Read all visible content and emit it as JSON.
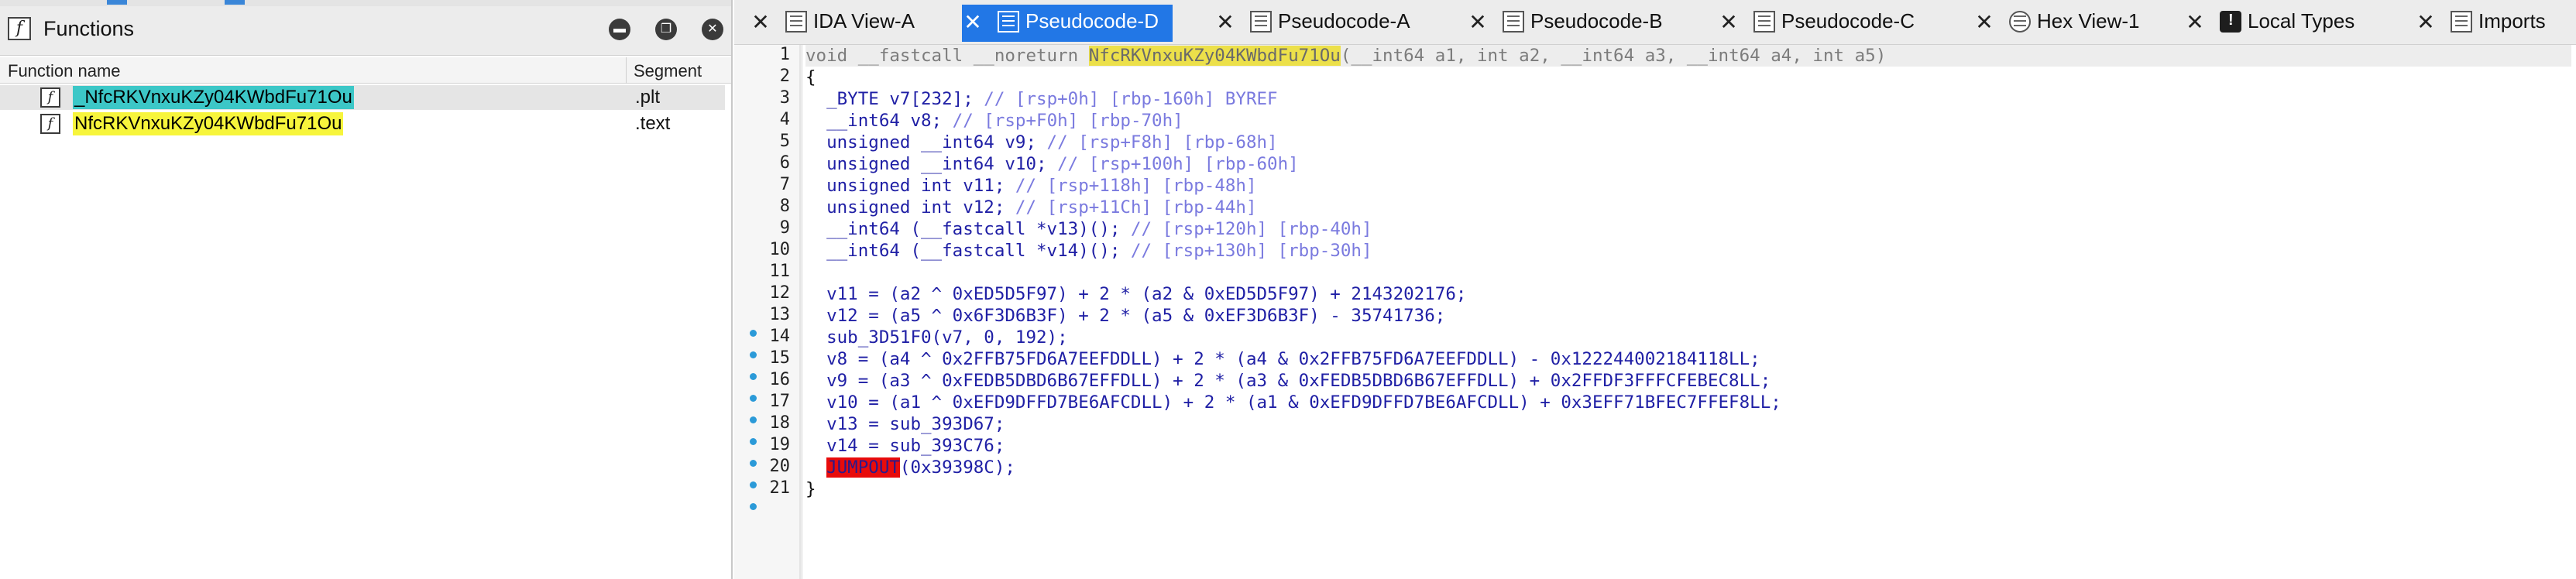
{
  "functions_window": {
    "title": "Functions",
    "columns": [
      "Function name",
      "Segment"
    ],
    "rows": [
      {
        "name": "_NfcRKVnxuKZy04KWbdFu71Ou",
        "segment": ".plt"
      },
      {
        "name": "NfcRKVnxuKZy04KWbdFu71Ou",
        "segment": ".text"
      }
    ],
    "header_icons": [
      "minimize-icon",
      "restore-icon",
      "close-icon"
    ]
  },
  "tabs": [
    {
      "label": "IDA View-A",
      "icon": "graph-icon"
    },
    {
      "label": "Pseudocode-D",
      "icon": "pseudocode-icon",
      "active": true
    },
    {
      "label": "Pseudocode-A",
      "icon": "pseudocode-icon"
    },
    {
      "label": "Pseudocode-B",
      "icon": "pseudocode-icon"
    },
    {
      "label": "Pseudocode-C",
      "icon": "pseudocode-icon"
    },
    {
      "label": "Hex View-1",
      "icon": "hex-icon"
    },
    {
      "label": "Local Types",
      "icon": "info-icon"
    },
    {
      "label": "Imports",
      "icon": "imports-icon"
    }
  ],
  "code": {
    "line_numbers": [
      "1",
      "2",
      "3",
      "4",
      "5",
      "6",
      "7",
      "8",
      "9",
      "10",
      "11",
      "12",
      "13",
      "14",
      "15",
      "16",
      "17",
      "18",
      "19",
      "20",
      "21"
    ],
    "sig_prefix": "void __fastcall __noreturn ",
    "sig_func": "NfcRKVnxuKZy04KWbdFu71Ou",
    "sig_args": "(__int64 a1, int a2, __int64 a3, __int64 a4, int a5)",
    "open_brace": "{",
    "close_brace": "}",
    "decl_v7": "  _BYTE v7[232];",
    "decl_v7_c": " // [rsp+0h] [rbp-160h] BYREF",
    "decl_v8": "  __int64 v8;",
    "decl_v8_c": " // [rsp+F0h] [rbp-70h]",
    "decl_v9": "  unsigned __int64 v9;",
    "decl_v9_c": " // [rsp+F8h] [rbp-68h]",
    "decl_v10": "  unsigned __int64 v10;",
    "decl_v10_c": " // [rsp+100h] [rbp-60h]",
    "decl_v11": "  unsigned int v11;",
    "decl_v11_c": " // [rsp+118h] [rbp-48h]",
    "decl_v12": "  unsigned int v12;",
    "decl_v12_c": " // [rsp+11Ch] [rbp-44h]",
    "decl_v13": "  __int64 (__fastcall *v13)();",
    "decl_v13_c": " // [rsp+120h] [rbp-40h]",
    "decl_v14": "  __int64 (__fastcall *v14)();",
    "decl_v14_c": " // [rsp+130h] [rbp-30h]",
    "l12": "  v11 = (a2 ^ 0xED5D5F97) + 2 * (a2 & 0xED5D5F97) + 2143202176;",
    "l13": "  v12 = (a5 ^ 0x6F3D6B3F) + 2 * (a5 & 0xEF3D6B3F) - 35741736;",
    "l14": "  sub_3D51F0(v7, 0, 192);",
    "l15": "  v8 = (a4 ^ 0x2FFB75FD6A7EEFDDLL) + 2 * (a4 & 0x2FFB75FD6A7EEFDDLL) - 0x122244002184118LL;",
    "l16": "  v9 = (a3 ^ 0xFEDB5DBD6B67EFFDLL) + 2 * (a3 & 0xFEDB5DBD6B67EFFDLL) + 0x2FFDF3FFFCFEBEC8LL;",
    "l17": "  v10 = (a1 ^ 0xEFD9DFFD7BE6AFCDLL) + 2 * (a1 & 0xEFD9DFFD7BE6AFCDLL) + 0x3EFF71BFEC7FFEF8LL;",
    "l18": "  v13 = sub_393D67;",
    "l19": "  v14 = sub_393C76;",
    "l20_indent": "  ",
    "l20_kw": "JUMPOUT",
    "l20_rest": "(0x39398C);"
  },
  "colors": {
    "active_tab": "#2277e6",
    "highlight_yellow": "#f7f53c",
    "highlight_cyan": "#3cc7c7",
    "jumpout_red": "#e80b0b"
  }
}
